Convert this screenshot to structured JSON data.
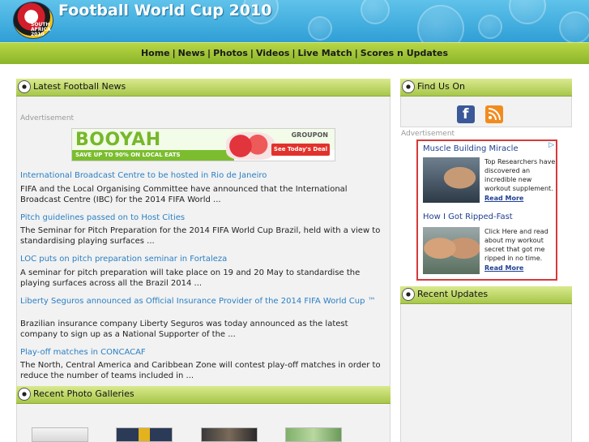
{
  "site": {
    "title": "Football World Cup 2010",
    "logo_text_1": "SOUTH",
    "logo_text_2": "AFRICA",
    "logo_text_3": "2010"
  },
  "nav": {
    "items": [
      "Home",
      "News",
      "Photos",
      "Videos",
      "Live Match",
      "Scores n Updates"
    ],
    "separator": "|"
  },
  "main": {
    "news_panel_title": "Latest Football News",
    "advertisement_label": "Advertisement",
    "banner": {
      "brand_word": "BOOYAH",
      "tagline": "SAVE UP TO 90% ON LOCAL EATS",
      "partner": "GROUPON",
      "cta": "See Today's Deal"
    },
    "news": [
      {
        "title": "International Broadcast Centre to be hosted in Rio de Janeiro",
        "desc": "FIFA and the Local Organising Committee have announced that the International Broadcast Centre (IBC) for the 2014 FIFA World ..."
      },
      {
        "title": "Pitch guidelines passed on to Host Cities",
        "desc": "The Seminar for Pitch Preparation for the 2014 FIFA World Cup Brazil, held with a view to standardising playing surfaces ..."
      },
      {
        "title": "LOC puts on pitch preparation seminar in Fortaleza",
        "desc": "A seminar for pitch preparation will take place on 19 and 20 May to standardise the playing surfaces across all the Brazil 2014 ..."
      },
      {
        "title": "Liberty Seguros announced as Official Insurance Provider of the 2014 FIFA World Cup ™",
        "desc": "Brazilian insurance company Liberty Seguros was today announced as the latest company to sign up as a National Supporter of the ..."
      },
      {
        "title": "Play-off matches in CONCACAF",
        "desc": "The North, Central America and Caribbean Zone will contest play-off matches in order to reduce the number of teams included in ..."
      }
    ],
    "gallery_panel_title": "Recent Photo Galleries"
  },
  "sidebar": {
    "find_us_title": "Find Us On",
    "facebook_glyph": "f",
    "advertisement_label": "Advertisement",
    "ad": {
      "choice_mark": "▷",
      "items": [
        {
          "headline": "Muscle Building Miracle",
          "text": "Top Researchers have discovered an incredible new workout supplement.",
          "more": "Read More"
        },
        {
          "headline": "How I Got Ripped-Fast",
          "text": "Click Here and read about my workout secret that got me ripped in no time.",
          "more": "Read More"
        }
      ]
    },
    "recent_updates_title": "Recent Updates"
  },
  "colors": {
    "header_blue": "#2f9fd6",
    "nav_green": "#9cc236",
    "link_blue": "#2a7fc4",
    "ad_border": "#d73a3a"
  }
}
